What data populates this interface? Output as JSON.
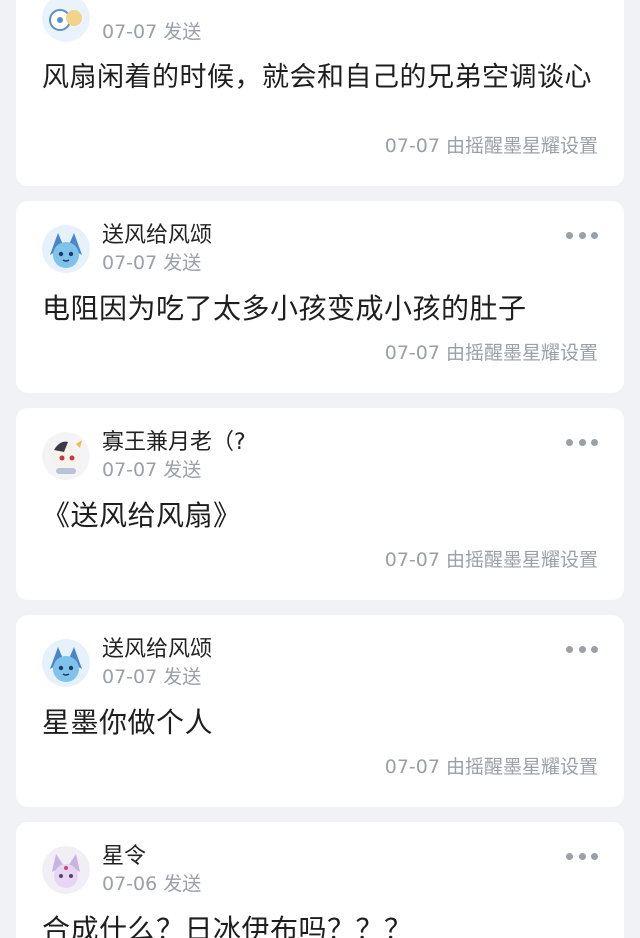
{
  "posts": [
    {
      "author": "",
      "sent": "07-07 发送",
      "content": "风扇闲着的时候，就会和自己的兄弟空调谈心",
      "footer": "07-07 由摇醒墨星耀设置",
      "avatar": "fan-avatar-icon"
    },
    {
      "author": "送风给风颂",
      "sent": "07-07 发送",
      "content": "电阻因为吃了太多小孩变成小孩的肚子",
      "footer": "07-07 由摇醒墨星耀设置",
      "avatar": "glaceon-avatar-icon"
    },
    {
      "author": "寡王兼月老（?",
      "sent": "07-07 发送",
      "content": "《送风给风扇》",
      "footer": "07-07 由摇醒墨星耀设置",
      "avatar": "anime-avatar-icon"
    },
    {
      "author": "送风给风颂",
      "sent": "07-07 发送",
      "content": "星墨你做个人",
      "footer": "07-07 由摇醒墨星耀设置",
      "avatar": "glaceon-avatar-icon"
    },
    {
      "author": "星令",
      "sent": "07-06 发送",
      "content": "合成什么？日冰伊布吗？？？",
      "footer": "",
      "avatar": "espeon-avatar-icon"
    }
  ],
  "colors": {
    "background": "#f1f2f5",
    "card": "#ffffff",
    "muted_text": "#9aa0a8",
    "primary_text": "#1e1e1e"
  },
  "more_icon": "more-dots-icon"
}
